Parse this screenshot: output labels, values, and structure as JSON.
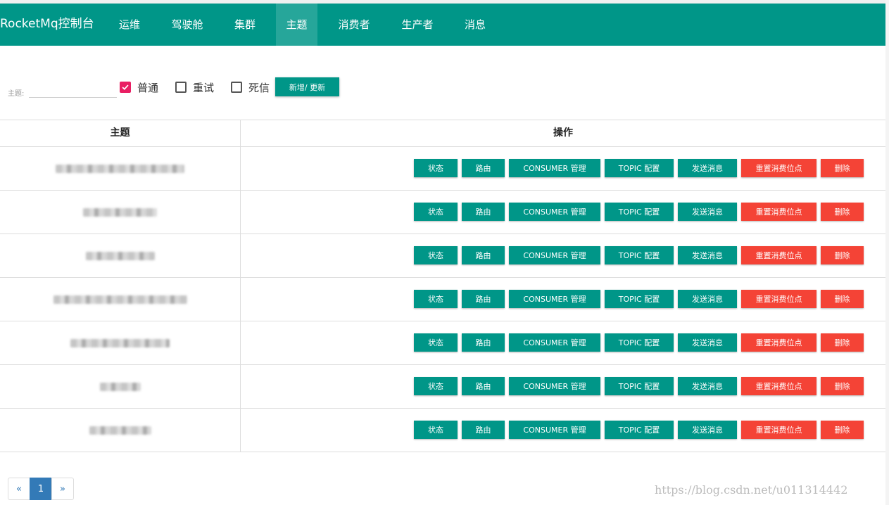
{
  "navbar": {
    "brand": "RocketMq控制台",
    "items": [
      {
        "label": "运维"
      },
      {
        "label": "驾驶舱"
      },
      {
        "label": "集群"
      },
      {
        "label": "主题"
      },
      {
        "label": "消费者"
      },
      {
        "label": "生产者"
      },
      {
        "label": "消息"
      }
    ],
    "active_item": "主题"
  },
  "filter": {
    "topic_label": "主题:",
    "topic_value": "",
    "checkboxes": [
      {
        "label": "普通",
        "checked": true
      },
      {
        "label": "重试",
        "checked": false
      },
      {
        "label": "死信",
        "checked": false
      }
    ],
    "add_update_button": "新增/ 更新"
  },
  "table": {
    "headers": {
      "topic": "主题",
      "operations": "操作"
    },
    "operation_buttons": [
      {
        "label": "状态",
        "color": "#009688"
      },
      {
        "label": "路由",
        "color": "#009688"
      },
      {
        "label": "CONSUMER 管理",
        "color": "#009688"
      },
      {
        "label": "TOPIC 配置",
        "color": "#009688"
      },
      {
        "label": "发送消息",
        "color": "#009688"
      },
      {
        "label": "重置消费位点",
        "color": "#f44336"
      },
      {
        "label": "删除",
        "color": "#f44336"
      }
    ],
    "rows": [
      {
        "topic": ""
      },
      {
        "topic": ""
      },
      {
        "topic": ""
      },
      {
        "topic": ""
      },
      {
        "topic": ""
      },
      {
        "topic": ""
      },
      {
        "topic": ""
      }
    ]
  },
  "pagination": {
    "prev": "«",
    "pages": [
      "1"
    ],
    "current": "1",
    "next": "»"
  },
  "watermark": "https://blog.csdn.net/u011314442",
  "colors": {
    "primary": "#009688",
    "danger": "#f44336",
    "checkbox_checked": "#e91e63",
    "pagination_active": "#337ab7"
  }
}
